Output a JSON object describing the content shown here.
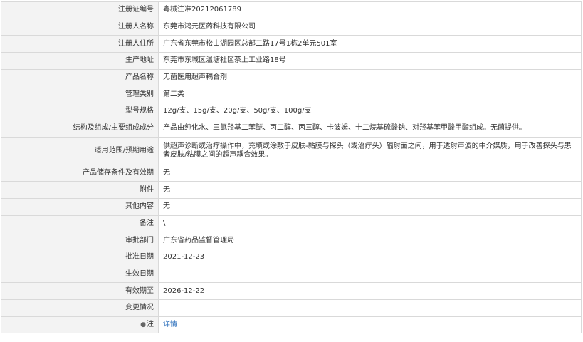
{
  "rows": [
    {
      "label": "注册证编号",
      "value": "粤械注准20212061789"
    },
    {
      "label": "注册人名称",
      "value": "东莞市鸿元医药科技有限公司"
    },
    {
      "label": "注册人住所",
      "value": "广东省东莞市松山湖园区总部二路17号1栋2单元501室"
    },
    {
      "label": "生产地址",
      "value": "东莞市东城区温塘社区茶上工业路18号"
    },
    {
      "label": "产品名称",
      "value": "无菌医用超声耦合剂"
    },
    {
      "label": "管理类别",
      "value": "第二类"
    },
    {
      "label": "型号规格",
      "value": "12g/支、15g/支、20g/支、50g/支、100g/支"
    },
    {
      "label": "结构及组成/主要组成成分",
      "value": "产品由纯化水、三氯羟基二苯醚、丙二醇、丙三醇、卡波姆、十二烷基硫酸钠、对羟基苯甲酸甲酯组成。无菌提供。"
    },
    {
      "label": "适用范围/预期用途",
      "value": "供超声诊断或治疗操作中，充填或涂敷于皮肤-黏膜与探头（或治疗头）辐射面之间，用于透射声波的中介媒质，用于改善探头与患者皮肤/粘膜之间的超声耦合效果。"
    },
    {
      "label": "产品储存条件及有效期",
      "value": "无"
    },
    {
      "label": "附件",
      "value": "无"
    },
    {
      "label": "其他内容",
      "value": "无"
    },
    {
      "label": "备注",
      "value": "\\"
    },
    {
      "label": "审批部门",
      "value": "广东省药品监督管理局"
    },
    {
      "label": "批准日期",
      "value": "2021-12-23"
    },
    {
      "label": "生效日期",
      "value": ""
    },
    {
      "label": "有效期至",
      "value": "2026-12-22"
    },
    {
      "label": "变更情况",
      "value": ""
    }
  ],
  "note": {
    "icon": "pin-icon",
    "label": "注",
    "link": "详情"
  }
}
